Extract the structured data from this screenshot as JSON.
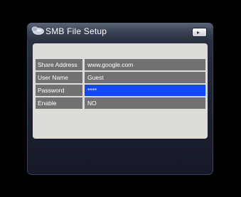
{
  "dialog": {
    "title": "SMB File Setup",
    "title_icon": "smb-folder-icon",
    "nav_button": {
      "icon": "arrow-right-icon",
      "glyph": "▸"
    }
  },
  "fields": [
    {
      "label": "Share Address",
      "value": "www.google.com"
    },
    {
      "label": "User Name",
      "value": "Guest"
    },
    {
      "label": "Password",
      "value": "****"
    },
    {
      "label": "Enable",
      "value": "NO"
    }
  ],
  "selected_field": "Password",
  "colors": {
    "selection": "#1446ff",
    "row": "#717171",
    "panel": "#dcdcd8"
  }
}
